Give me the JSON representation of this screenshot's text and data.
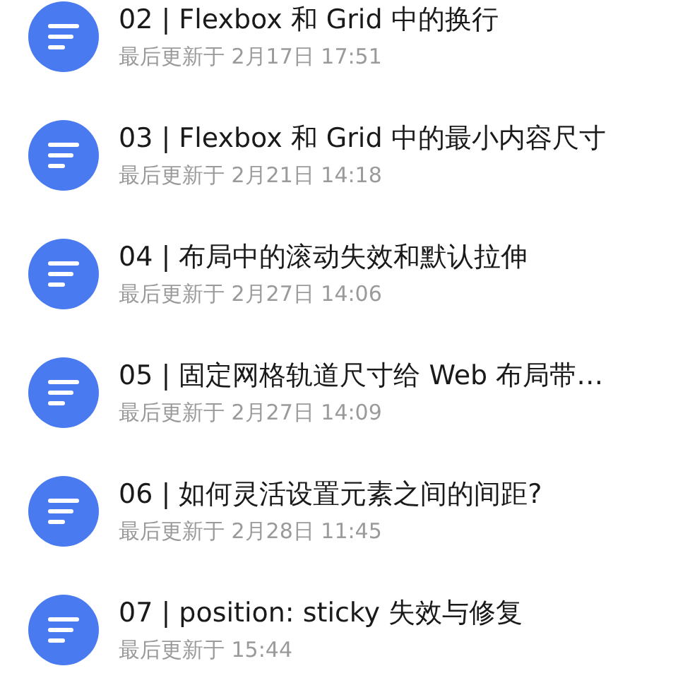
{
  "articles": [
    {
      "title": "02 | Flexbox 和 Grid 中的换行",
      "updated": "最后更新于 2月17日 17:51"
    },
    {
      "title": "03 | Flexbox 和 Grid 中的最小内容尺寸",
      "updated": "最后更新于 2月21日 14:18"
    },
    {
      "title": "04 | 布局中的滚动失效和默认拉伸",
      "updated": "最后更新于 2月27日 14:06"
    },
    {
      "title": "05 | 固定网格轨道尺寸给 Web 布局带…",
      "updated": "最后更新于 2月27日 14:09"
    },
    {
      "title": "06 | 如何灵活设置元素之间的间距?",
      "updated": "最后更新于 2月28日 11:45"
    },
    {
      "title": "07 | position: sticky 失效与修复",
      "updated": "最后更新于 15:44"
    }
  ]
}
